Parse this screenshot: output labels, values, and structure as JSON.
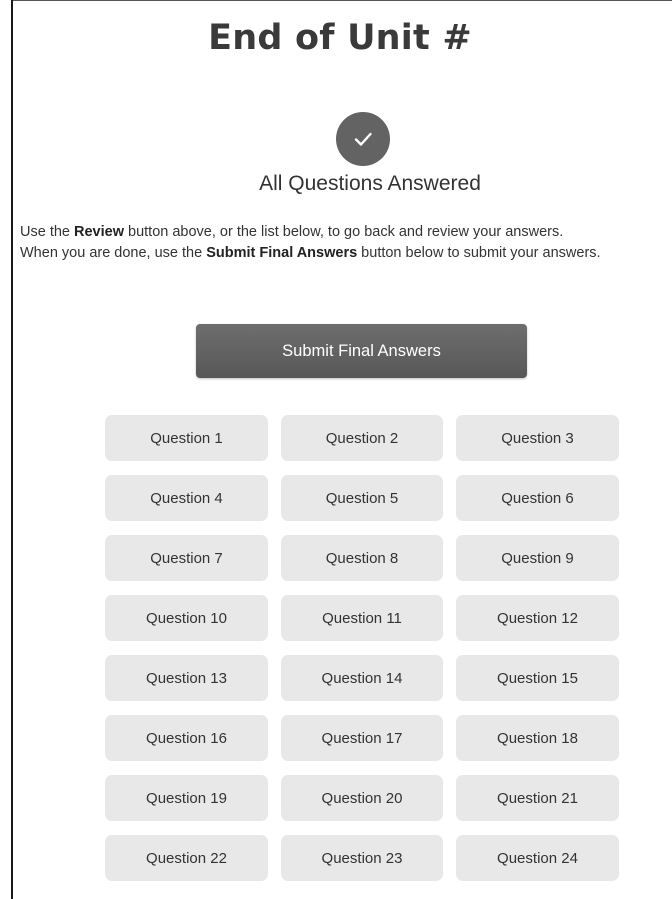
{
  "page": {
    "title": "End of Unit #",
    "status_icon": "check-icon",
    "status_text": "All Questions Answered"
  },
  "instructions": {
    "line1_pre": "Use the ",
    "line1_bold": "Review",
    "line1_post": " button above, or the list below, to go back and review your answers.",
    "line2_pre": "When you are done, use the ",
    "line2_bold": "Submit Final Answers",
    "line2_post": " button below to submit your answers."
  },
  "submit": {
    "label": "Submit Final Answers"
  },
  "questions": [
    "Question 1",
    "Question 2",
    "Question 3",
    "Question 4",
    "Question 5",
    "Question 6",
    "Question 7",
    "Question 8",
    "Question 9",
    "Question 10",
    "Question 11",
    "Question 12",
    "Question 13",
    "Question 14",
    "Question 15",
    "Question 16",
    "Question 17",
    "Question 18",
    "Question 19",
    "Question 20",
    "Question 21",
    "Question 22",
    "Question 23",
    "Question 24"
  ],
  "colors": {
    "check_circle": "#636363",
    "submit_button": "#5f5f5f",
    "question_button": "#e8e8e8"
  }
}
